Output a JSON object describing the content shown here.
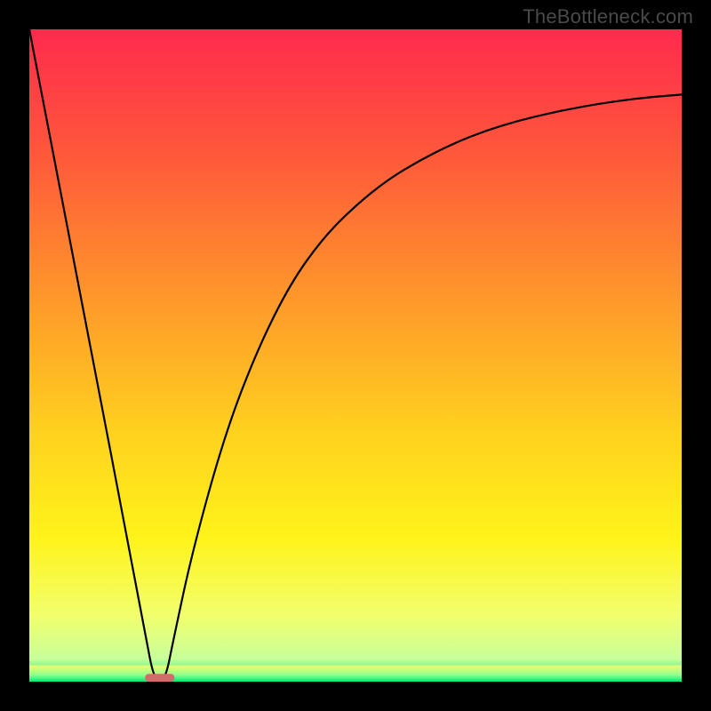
{
  "watermark": "TheBottleneck.com",
  "chart_data": {
    "type": "line",
    "title": "",
    "xlabel": "",
    "ylabel": "",
    "xlim": [
      0,
      100
    ],
    "ylim": [
      0,
      100
    ],
    "series": [
      {
        "name": "curve",
        "x": [
          0,
          5,
          10,
          15,
          18,
          19,
          20,
          21,
          22,
          25,
          30,
          35,
          40,
          45,
          50,
          55,
          60,
          65,
          70,
          75,
          80,
          85,
          90,
          95,
          100
        ],
        "values": [
          100,
          74,
          48,
          22,
          6,
          1,
          0,
          1,
          6,
          20,
          38,
          51,
          61,
          68,
          73,
          77,
          80,
          82.5,
          84.5,
          86,
          87.2,
          88.2,
          89,
          89.6,
          90
        ]
      }
    ],
    "marker": {
      "x": 20,
      "y": 0,
      "width": 4.5,
      "height": 1.2,
      "color": "#d46a6a"
    },
    "baseline_band": {
      "y0": 0,
      "y1": 2.5
    },
    "gradient_stops": [
      {
        "offset": 0.0,
        "color": "#ff2a4d"
      },
      {
        "offset": 0.2,
        "color": "#ff5a3a"
      },
      {
        "offset": 0.42,
        "color": "#ff9a2a"
      },
      {
        "offset": 0.62,
        "color": "#ffd21f"
      },
      {
        "offset": 0.78,
        "color": "#fff31a"
      },
      {
        "offset": 0.9,
        "color": "#f1ff6e"
      },
      {
        "offset": 0.965,
        "color": "#c8ff9a"
      },
      {
        "offset": 1.0,
        "color": "#00e676"
      }
    ]
  }
}
